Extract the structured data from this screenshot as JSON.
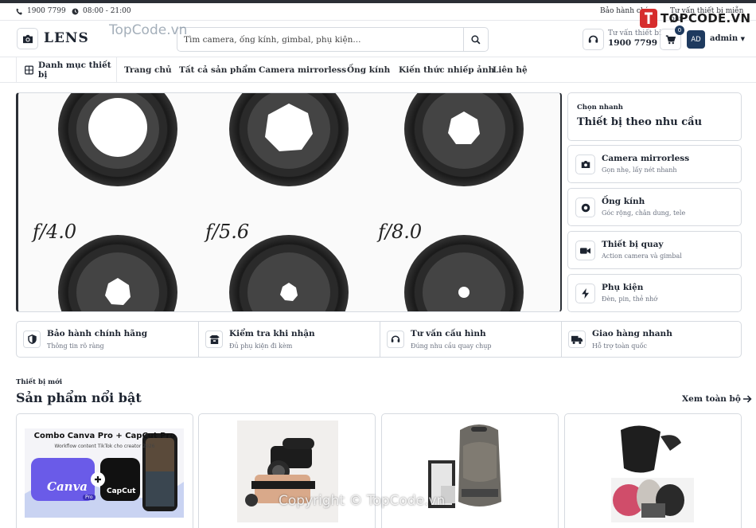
{
  "topbar": {
    "phone": "1900 7799",
    "hours": "08:00 - 21:00",
    "warranty_link": "Bảo hành chí",
    "consult_link": "Tư vấn thiết bị miễn phí"
  },
  "header": {
    "logo_text": "LENS",
    "search_placeholder": "Tìm camera, ống kính, gimbal, phụ kiện...",
    "hotline_label": "Tư vấn thiết bị",
    "hotline_number": "1900 7799",
    "cart_count": "0",
    "avatar_initials": "AD",
    "user_name": "admin"
  },
  "nav": {
    "category_label": "Danh mục thiết bị",
    "links": [
      "Trang chủ",
      "Tất cả sản phẩm",
      "Camera mirrorless",
      "Ống kính",
      "Kiến thức nhiếp ảnh",
      "Liên hệ"
    ]
  },
  "hero": {
    "lens_labels": [
      "f/4.0",
      "f/5.6",
      "f/8.0"
    ]
  },
  "quick_select": {
    "kicker": "Chọn nhanh",
    "title": "Thiết bị theo nhu cầu",
    "items": [
      {
        "name": "Camera mirrorless",
        "desc": "Gọn nhẹ, lấy nét nhanh",
        "icon": "camera-icon"
      },
      {
        "name": "Ống kính",
        "desc": "Góc rộng, chân dung, tele",
        "icon": "lens-icon"
      },
      {
        "name": "Thiết bị quay",
        "desc": "Action camera và gimbal",
        "icon": "video-icon"
      },
      {
        "name": "Phụ kiện",
        "desc": "Đèn, pin, thẻ nhớ",
        "icon": "bolt-icon"
      }
    ]
  },
  "features": [
    {
      "name": "Bảo hành chính hãng",
      "desc": "Thông tin rõ ràng",
      "icon": "shield-icon"
    },
    {
      "name": "Kiểm tra khi nhận",
      "desc": "Đủ phụ kiện đi kèm",
      "icon": "box-icon"
    },
    {
      "name": "Tư vấn cấu hình",
      "desc": "Đúng nhu cầu quay chụp",
      "icon": "headset-icon"
    },
    {
      "name": "Giao hàng nhanh",
      "desc": "Hỗ trợ toàn quốc",
      "icon": "truck-icon"
    }
  ],
  "products_section": {
    "kicker": "Thiết bị mới",
    "title": "Sản phẩm nổi bật",
    "view_all": "Xem toàn bộ"
  },
  "product_cards": [
    {
      "headline": "Combo Canva Pro + CapCut Pro",
      "subline": "Workflow content TikTok cho creator 2026",
      "brand_a": "Canva",
      "brand_b": "CapCut",
      "badge": "Pro"
    },
    {
      "image": "camera-rig-photo"
    },
    {
      "image": "camera-backpack-photo"
    },
    {
      "image": "camera-bag-photo"
    }
  ],
  "watermarks": {
    "site": "TopCode.vn",
    "copyright": "Copyright © TopCode.vn",
    "logo": "TOPCODE.VN"
  },
  "colors": {
    "primary": "#1e3a5f",
    "text": "#1d2430",
    "muted": "#6b7280",
    "border": "#d6dae0"
  }
}
